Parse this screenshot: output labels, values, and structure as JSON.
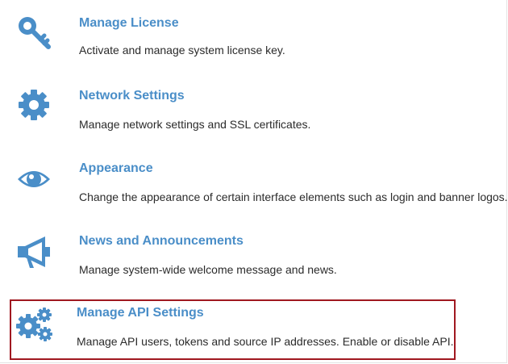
{
  "settings": {
    "items": [
      {
        "icon": "key-icon",
        "title": "Manage License",
        "description": "Activate and manage system license key."
      },
      {
        "icon": "gear-icon",
        "title": "Network Settings",
        "description": "Manage network settings and SSL certificates."
      },
      {
        "icon": "eye-icon",
        "title": "Appearance",
        "description": "Change the appearance of certain interface elements such as login and banner logos."
      },
      {
        "icon": "megaphone-icon",
        "title": "News and Announcements",
        "description": "Manage system-wide welcome message and news."
      },
      {
        "icon": "gears-icon",
        "title": "Manage API Settings",
        "description": "Manage API users, tokens and source IP addresses. Enable or disable API.",
        "highlighted": true
      }
    ]
  },
  "colors": {
    "accent": "#4a8ec8",
    "text": "#2b2b2b",
    "highlight": "#a01820"
  }
}
